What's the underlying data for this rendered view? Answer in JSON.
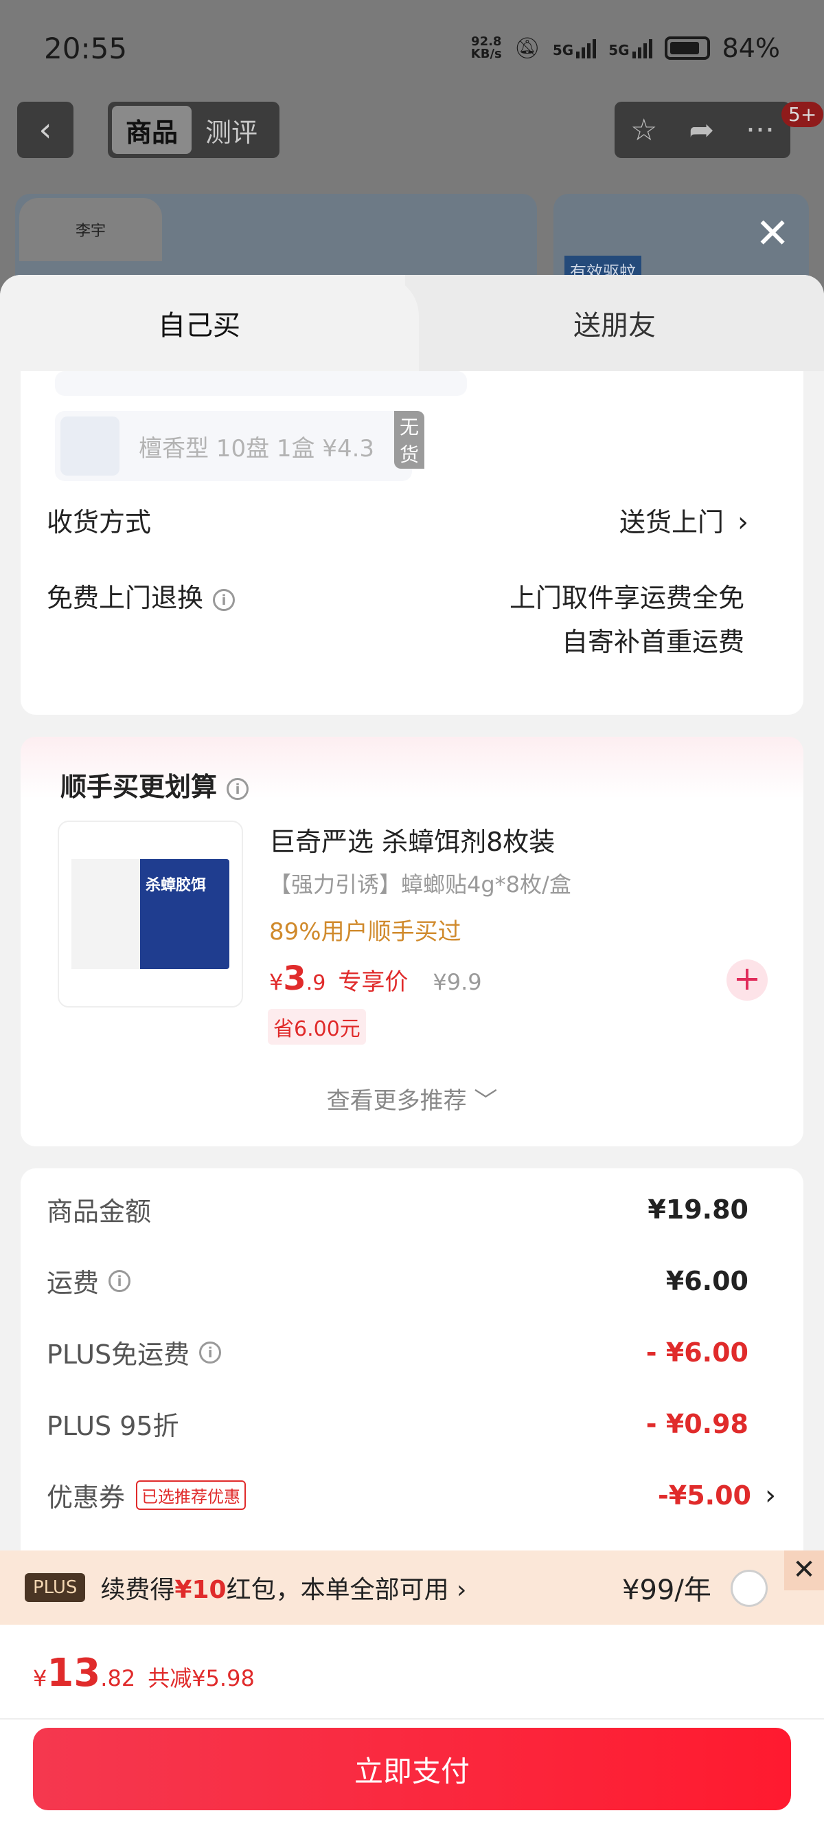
{
  "status": {
    "time": "20:55",
    "speed_value": "92.8",
    "speed_unit": "KB/s",
    "net1": "5G",
    "net2": "5G",
    "battery": "84%"
  },
  "nav": {
    "back_icon": "chevron-left-icon",
    "tabs": [
      {
        "label": "商品"
      },
      {
        "label": "测评"
      }
    ],
    "badge": "5+"
  },
  "bg": {
    "brand": "李宇",
    "tag": "有效驱蚊"
  },
  "sheet": {
    "tabs": [
      {
        "label": "自己买"
      },
      {
        "label": "送朋友"
      }
    ],
    "spec": {
      "name": "檀香型 10盘 1盒",
      "price": "¥4.3",
      "stock_badge": "无货"
    },
    "delivery": {
      "label": "收货方式",
      "value": "送货上门"
    },
    "returns": {
      "label": "免费上门退换",
      "line1": "上门取件享运费全免",
      "line2": "自寄补首重运费"
    },
    "rec": {
      "title": "顺手买更划算",
      "product_name": "巨奇严选 杀蟑饵剂8枚装",
      "desc": "【强力引诱】蟑螂贴4g*8枚/盒",
      "social": "89%用户顺手买过",
      "price_currency": "¥",
      "price_int": "3",
      "price_dec": ".9",
      "price_label": "专享价",
      "orig_price": "¥9.9",
      "save": "省6.00元",
      "more": "查看更多推荐 ﹀",
      "box_text": "杀蟑胶饵"
    },
    "summary": {
      "goods_label": "商品金额",
      "goods_value": "¥19.80",
      "freight_label": "运费",
      "freight_value": "¥6.00",
      "plus_free_label": "PLUS免运费",
      "plus_free_value": "- ¥6.00",
      "plus95_label": "PLUS 95折",
      "plus95_value": "- ¥0.98",
      "coupon_label": "优惠券",
      "coupon_tag": "已选推荐优惠",
      "coupon_value": "-¥5.00"
    },
    "plus_bar": {
      "logo": "PLUS",
      "text_pre": "续费得",
      "text_hl": "¥10",
      "text_post": "红包，本单全部可用 ›",
      "price": "¥99/年"
    },
    "pay": {
      "cur": "¥",
      "int": "13",
      "dec": ".82",
      "discount": "共减¥5.98",
      "button": "立即支付"
    }
  }
}
